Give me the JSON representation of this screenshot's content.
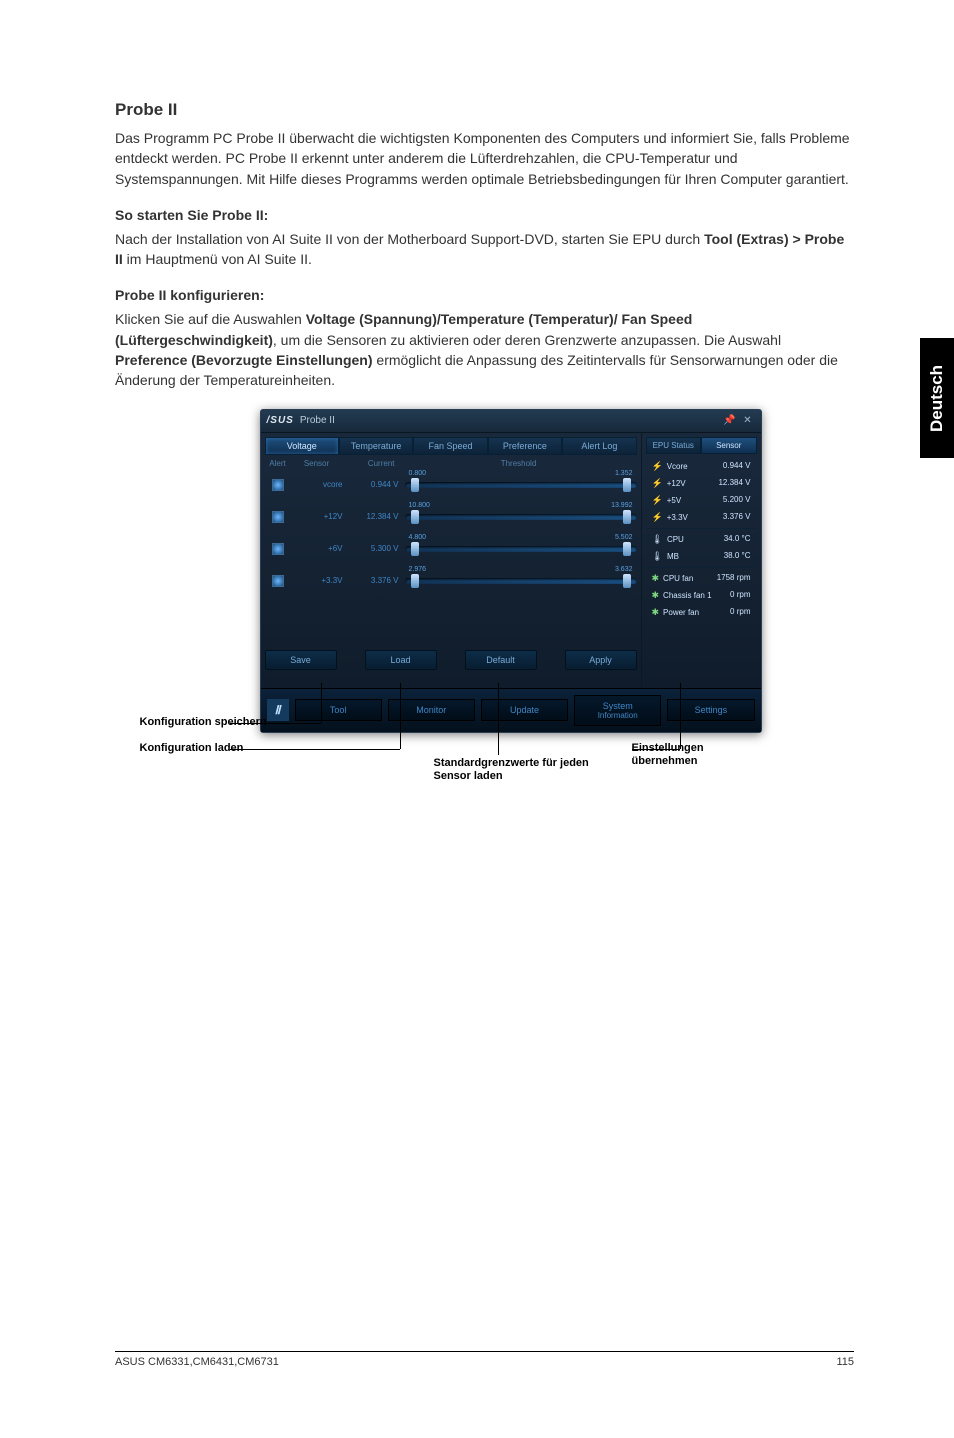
{
  "page": {
    "title": "Probe II",
    "intro": "Das Programm PC Probe II überwacht die wichtigsten Komponenten des Computers und informiert Sie, falls Probleme entdeckt werden. PC Probe II erkennt unter anderem die Lüfterdrehzahlen, die CPU-Temperatur und Systemspannungen. Mit Hilfe dieses Programms werden optimale Betriebsbedingungen für Ihren Computer garantiert.",
    "start_head": "So starten Sie Probe II:",
    "start_body_pre": "Nach der Installation von AI Suite II von der Motherboard Support-DVD, starten Sie EPU durch ",
    "start_body_bold": "Tool (Extras) > Probe II",
    "start_body_post": " im Hauptmenü von AI Suite II.",
    "config_head": "Probe II konfigurieren:",
    "config_body_pre": "Klicken Sie auf die Auswahlen ",
    "config_body_bold1": "Voltage (Spannung)/Temperature (Temperatur)/ Fan Speed (Lüftergeschwindigkeit)",
    "config_body_mid": ", um die Sensoren zu aktivieren oder deren Grenzwerte anzupassen. Die Auswahl ",
    "config_body_bold2": "Preference (Bevorzugte Einstellungen)",
    "config_body_post": " ermöglicht die Anpassung des Zeitintervalls für Sensorwarnungen oder die Änderung der Temperatureinheiten.",
    "side_tab": "Deutsch",
    "footer_left": "ASUS CM6331,CM6431,CM6731",
    "footer_right": "115"
  },
  "callouts": {
    "save": "Konfiguration speichern",
    "load": "Konfiguration laden",
    "default": "Standardgrenzwerte für jeden Sensor laden",
    "apply": "Einstellungen übernehmen"
  },
  "app": {
    "brand": "/SUS",
    "name": "Probe II",
    "tabs": {
      "voltage": "Voltage",
      "temperature": "Temperature",
      "fanspeed": "Fan Speed",
      "preference": "Preference",
      "alertlog": "Alert Log"
    },
    "cols": {
      "alert": "Alert",
      "sensor": "Sensor",
      "current": "Current",
      "threshold": "Threshold"
    },
    "sensors": [
      {
        "name": "vcore",
        "value": "0.944 V",
        "low": "0.800",
        "high": "1.352"
      },
      {
        "name": "+12V",
        "value": "12.384 V",
        "low": "10.800",
        "high": "13.992"
      },
      {
        "name": "+6V",
        "value": "5.300 V",
        "low": "4.800",
        "high": "5.502"
      },
      {
        "name": "+3.3V",
        "value": "3.376 V",
        "low": "2.976",
        "high": "3.632"
      }
    ],
    "bottom": {
      "save": "Save",
      "load": "Load",
      "default": "Default",
      "apply": "Apply"
    },
    "launcher": {
      "tool": "Tool",
      "monitor": "Monitor",
      "update": "Update",
      "sysinfo_top": "System",
      "sysinfo_bot": "Information",
      "settings": "Settings"
    },
    "status": {
      "tabs": {
        "epu": "EPU Status",
        "sensor": "Sensor"
      },
      "rows": [
        {
          "icon": "volt",
          "label": "Vcore",
          "value": "0.944 V"
        },
        {
          "icon": "volt",
          "label": "+12V",
          "value": "12.384 V"
        },
        {
          "icon": "volt",
          "label": "+5V",
          "value": "5.200 V"
        },
        {
          "icon": "volt",
          "label": "+3.3V",
          "value": "3.376 V"
        },
        {
          "icon": "temp",
          "label": "CPU",
          "value": "34.0 °C"
        },
        {
          "icon": "temp",
          "label": "MB",
          "value": "38.0 °C"
        },
        {
          "icon": "fan",
          "label": "CPU fan",
          "value": "1758 rpm"
        },
        {
          "icon": "fan",
          "label": "Chassis fan 1",
          "value": "0 rpm"
        },
        {
          "icon": "fan",
          "label": "Power fan",
          "value": "0 rpm"
        }
      ]
    }
  }
}
